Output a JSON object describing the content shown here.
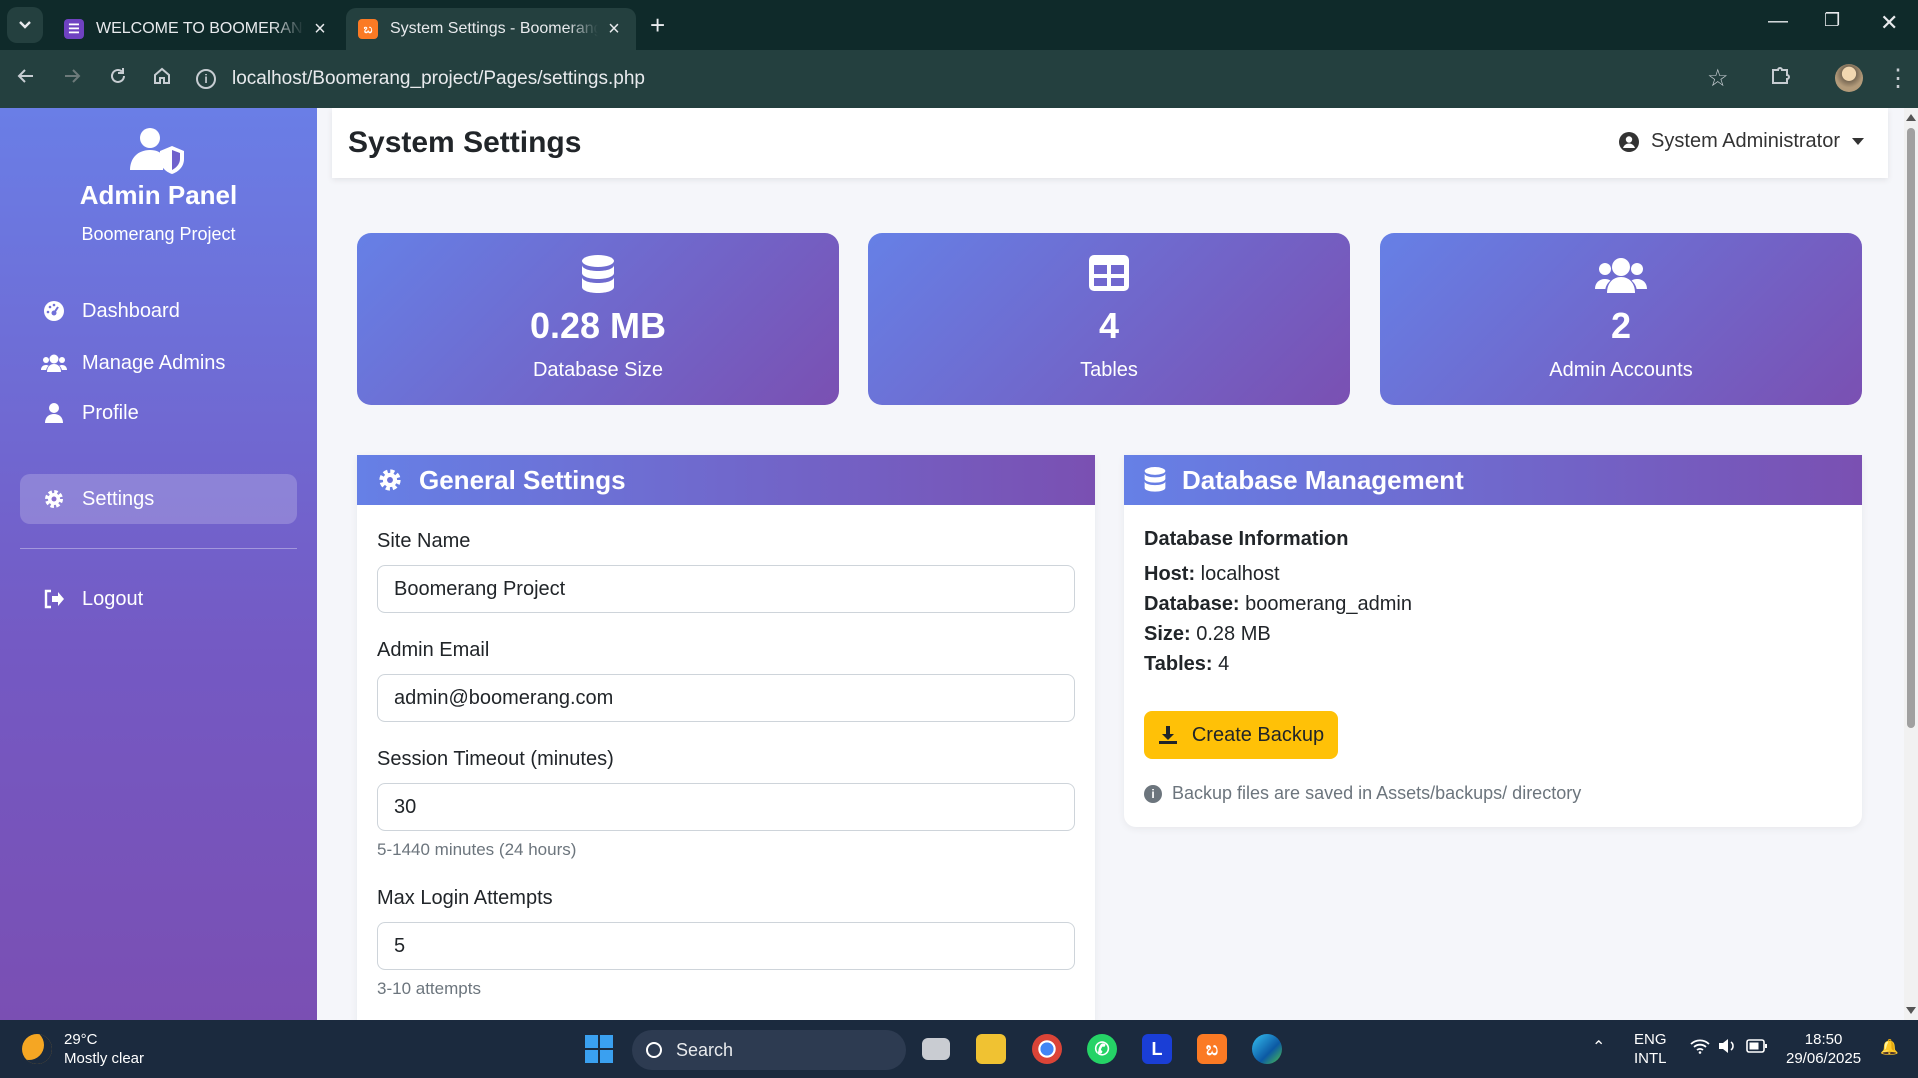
{
  "browser": {
    "tabs": [
      {
        "title": "WELCOME TO BOOMERANG SC",
        "active": false
      },
      {
        "title": "System Settings - Boomerang P",
        "active": true
      }
    ],
    "url": "localhost/Boomerang_project/Pages/settings.php"
  },
  "sidebar": {
    "title": "Admin Panel",
    "subtitle": "Boomerang Project",
    "items": [
      {
        "label": "Dashboard",
        "icon": "gauge-icon"
      },
      {
        "label": "Manage Admins",
        "icon": "users-icon"
      },
      {
        "label": "Profile",
        "icon": "user-icon"
      },
      {
        "label": "Settings",
        "icon": "gear-icon",
        "active": true
      }
    ],
    "logout": "Logout"
  },
  "header": {
    "title": "System Settings",
    "user": "System Administrator"
  },
  "stats": [
    {
      "value": "0.28 MB",
      "label": "Database Size",
      "icon": "database-icon"
    },
    {
      "value": "4",
      "label": "Tables",
      "icon": "table-icon"
    },
    {
      "value": "2",
      "label": "Admin Accounts",
      "icon": "users-icon"
    }
  ],
  "general": {
    "title": "General Settings",
    "site_name_label": "Site Name",
    "site_name_value": "Boomerang Project",
    "admin_email_label": "Admin Email",
    "admin_email_value": "admin@boomerang.com",
    "session_label": "Session Timeout (minutes)",
    "session_value": "30",
    "session_help": "5-1440 minutes (24 hours)",
    "login_label": "Max Login Attempts",
    "login_value": "5",
    "login_help": "3-10 attempts"
  },
  "database": {
    "title": "Database Management",
    "info_title": "Database Information",
    "host_label": "Host:",
    "host_value": "localhost",
    "db_label": "Database:",
    "db_value": "boomerang_admin",
    "size_label": "Size:",
    "size_value": "0.28 MB",
    "tables_label": "Tables:",
    "tables_value": "4",
    "backup_button": "Create Backup",
    "note": "Backup files are saved in Assets/backups/ directory"
  },
  "taskbar": {
    "temperature": "29°C",
    "weather": "Mostly clear",
    "search": "Search",
    "lang1": "ENG",
    "lang2": "INTL",
    "time": "18:50",
    "date": "29/06/2025"
  },
  "colors": {
    "accent_start": "#6680e6",
    "accent_end": "#7a50b2",
    "backup_button": "#ffc107",
    "chrome_bg": "#0f2a2a"
  }
}
